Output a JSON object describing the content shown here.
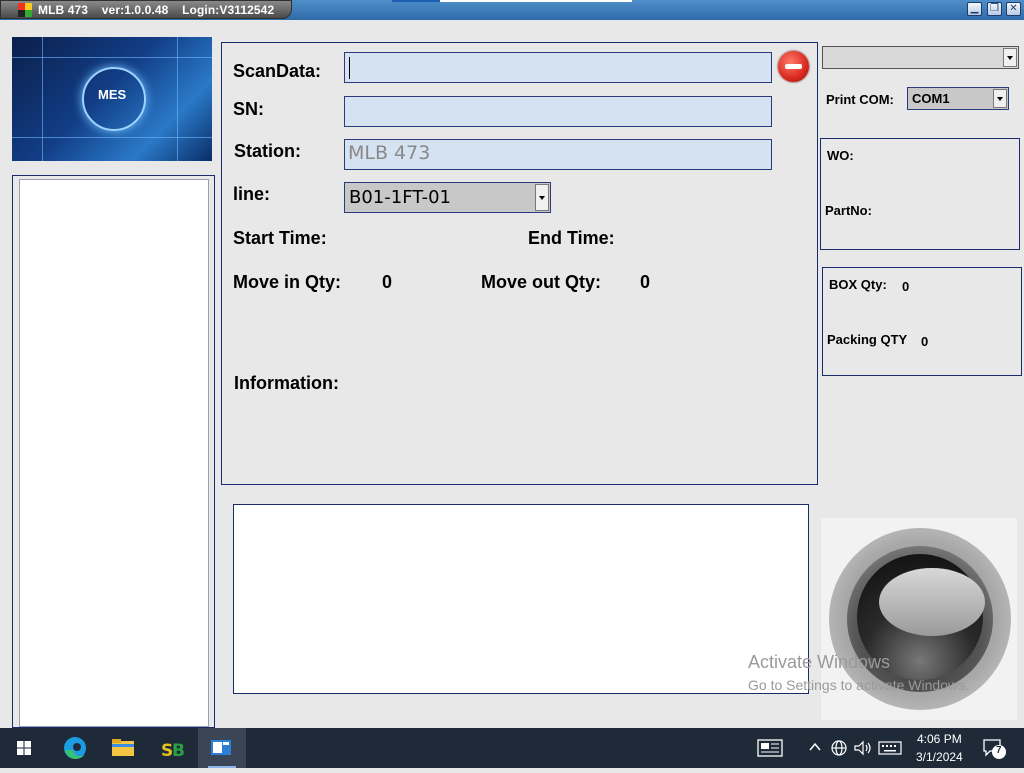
{
  "window": {
    "title": "MLB 473    ver:1.0.0.48    Login:V3112542",
    "controls": {
      "minimize": "▁",
      "restore": "❐",
      "close": "✕"
    }
  },
  "logo": {
    "text": "MES"
  },
  "form": {
    "scandata_label": "ScanData:",
    "scandata_value": "",
    "sn_label": "SN:",
    "sn_value": "",
    "station_label": "Station:",
    "station_value": "MLB 473",
    "line_label": "line:",
    "line_value": "B01-1FT-01",
    "start_time_label": "Start Time:",
    "end_time_label": "End Time:",
    "move_in_label": "Move in Qty:",
    "move_in_value": "0",
    "move_out_label": "Move out Qty:",
    "move_out_value": "0",
    "information_label": "Information:"
  },
  "right": {
    "top_combo_value": "",
    "print_com_label": "Print COM:",
    "print_com_value": "COM1",
    "wo_label": "WO:",
    "partno_label": "PartNo:",
    "box_qty_label": "BOX Qty:",
    "box_qty_value": "0",
    "packing_qty_label": "Packing QTY",
    "packing_qty_value": "0"
  },
  "watermark": {
    "line1": "Activate Windows",
    "line2": "Go to Settings to activate Windows."
  },
  "taskbar": {
    "time": "4:06 PM",
    "date": "3/1/2024",
    "notification_count": "7",
    "pinned": [
      "start-icon",
      "edge-icon",
      "file-explorer-icon",
      "app-sb-icon",
      "mes-app-icon"
    ]
  },
  "colors": {
    "field_bg": "#d5e2f2",
    "panel_border": "#1a2a6a",
    "stop_red": "#d82a1e",
    "taskbar_bg": "#1f2a38"
  }
}
